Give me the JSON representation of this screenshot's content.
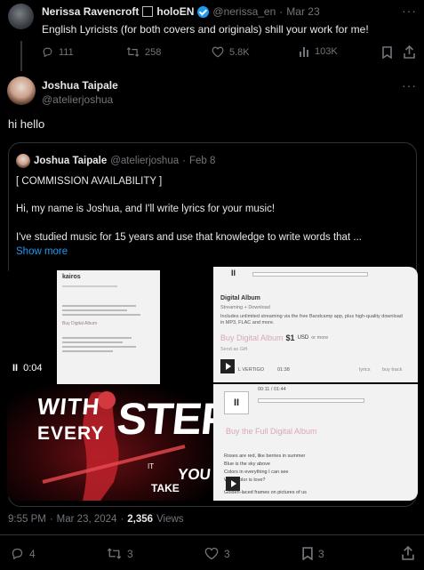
{
  "top_tweet": {
    "name": "Nerissa Ravencroft",
    "name_tail": "holoEN",
    "handle": "@nerissa_en",
    "sep": "·",
    "date": "Mar 23",
    "text": "English Lyricists (for both covers and originals) shill your work for me!",
    "stats": {
      "replies": "111",
      "retweets": "258",
      "likes": "5.8K",
      "views": "103K"
    }
  },
  "reply": {
    "name": "Joshua Taipale",
    "handle": "@atelierjoshua",
    "text": "hi hello"
  },
  "quoted": {
    "name": "Joshua Taipale",
    "handle": "@atelierjoshua",
    "sep": "·",
    "date": "Feb 8",
    "line1": "[ COMMISSION AVAILABILITY ]",
    "line2": "Hi, my name is Joshua, and I'll write lyrics for your music!",
    "line3": "I've studied music for 15 years and use that knowledge to write words that ...",
    "show_more": "Show more"
  },
  "video": {
    "time": "0:04",
    "pause_glyph": "II",
    "left_doc_title": "kairos",
    "left_doc_buy": "Buy Digital Album",
    "overlay_with": "WITH",
    "overlay_every": "EVERY",
    "overlay_step": "STEP",
    "overlay_it": "IT",
    "overlay_take": "TAKE",
    "overlay_you": "YOU",
    "bc_top": {
      "album": "Digital Album",
      "sub": "Streaming + Download",
      "desc": "Includes unlimited streaming via the free Bandcamp app, plus high-quality download in MP3, FLAC and more.",
      "buy": "Buy Digital Album",
      "price": "$1",
      "currency": "USD",
      "or_more": "or more",
      "gift": "Send as Gift",
      "track": "L VERTIGO",
      "track_time": "01:38",
      "lyrics": "lyrics",
      "buy_track": "buy track"
    },
    "bc_bottom": {
      "time": "00:11 / 01:44",
      "buy_full": "Buy the Full Digital Album",
      "lyrics": [
        "Roses are red, like berries in summer",
        "Blue is the sky above",
        "Colors in everything I can see",
        "What color is love?",
        "Golden-laced frames on pictures of us"
      ]
    }
  },
  "footer": {
    "time": "9:55 PM",
    "sep": "·",
    "date": "Mar 23, 2024",
    "sep2": "·",
    "views_count": "2,356",
    "views_label": "Views"
  },
  "bottom_stats": {
    "replies": "4",
    "retweets": "3",
    "likes": "3",
    "bookmarks": "3"
  },
  "colors": {
    "accent": "#1d9bf0",
    "muted": "#71767b",
    "border": "#2f3336",
    "bandcamp_link": "#d9a7b5"
  }
}
